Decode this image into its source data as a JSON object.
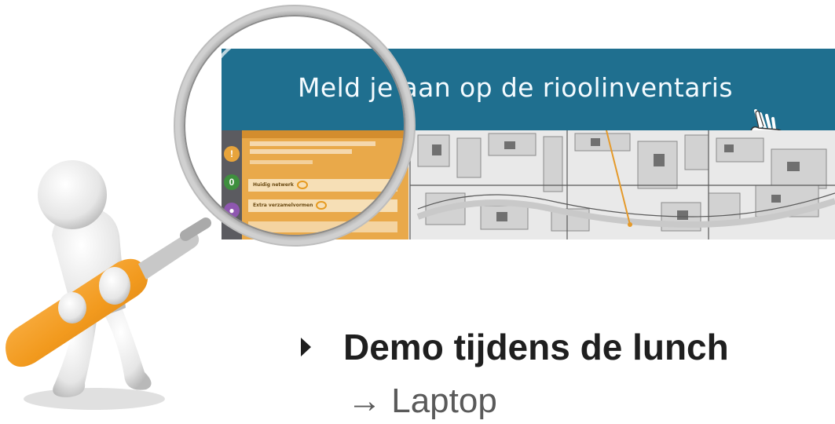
{
  "banner": {
    "title": "Meld je aan op de rioolinventaris",
    "hand_icon": "pointing-hand-icon",
    "colors": {
      "header": "#1f6f8f",
      "panel": "#e9a94a"
    }
  },
  "app_panel": {
    "rows": [
      {
        "label": "Huidig netwerk"
      },
      {
        "label": "Extra verzamelvormen"
      }
    ]
  },
  "illustration": {
    "icon": "magnifying-glass-icon",
    "figure": "person-figure"
  },
  "bullets": [
    {
      "text": "Demo tijdens de lunch",
      "sub": "→ Laptop"
    }
  ]
}
